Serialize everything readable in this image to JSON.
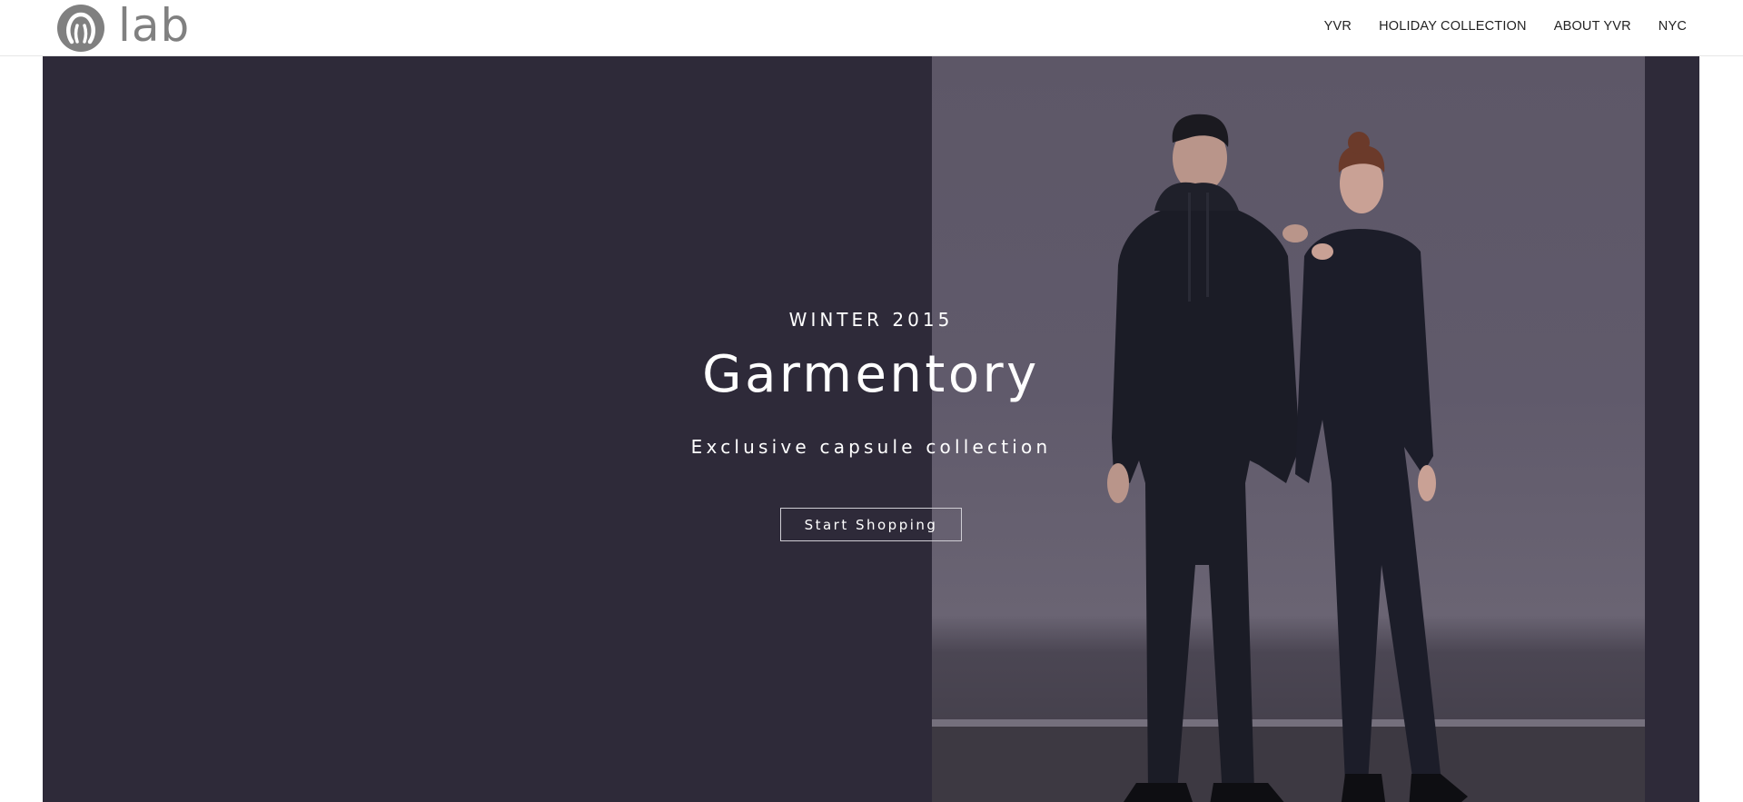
{
  "header": {
    "logo_text": "lab",
    "logo_icon": "lululemon-omega-icon",
    "nav": [
      {
        "label": "YVR"
      },
      {
        "label": "HOLIDAY COLLECTION"
      },
      {
        "label": "ABOUT YVR"
      },
      {
        "label": "NYC"
      }
    ]
  },
  "hero": {
    "eyebrow": "WINTER 2015",
    "title": "Garmentory",
    "subtitle": "Exclusive capsule collection",
    "cta_label": "Start Shopping",
    "background_color": "#2e2a39",
    "photo_backdrop_color": "#5d5767"
  }
}
